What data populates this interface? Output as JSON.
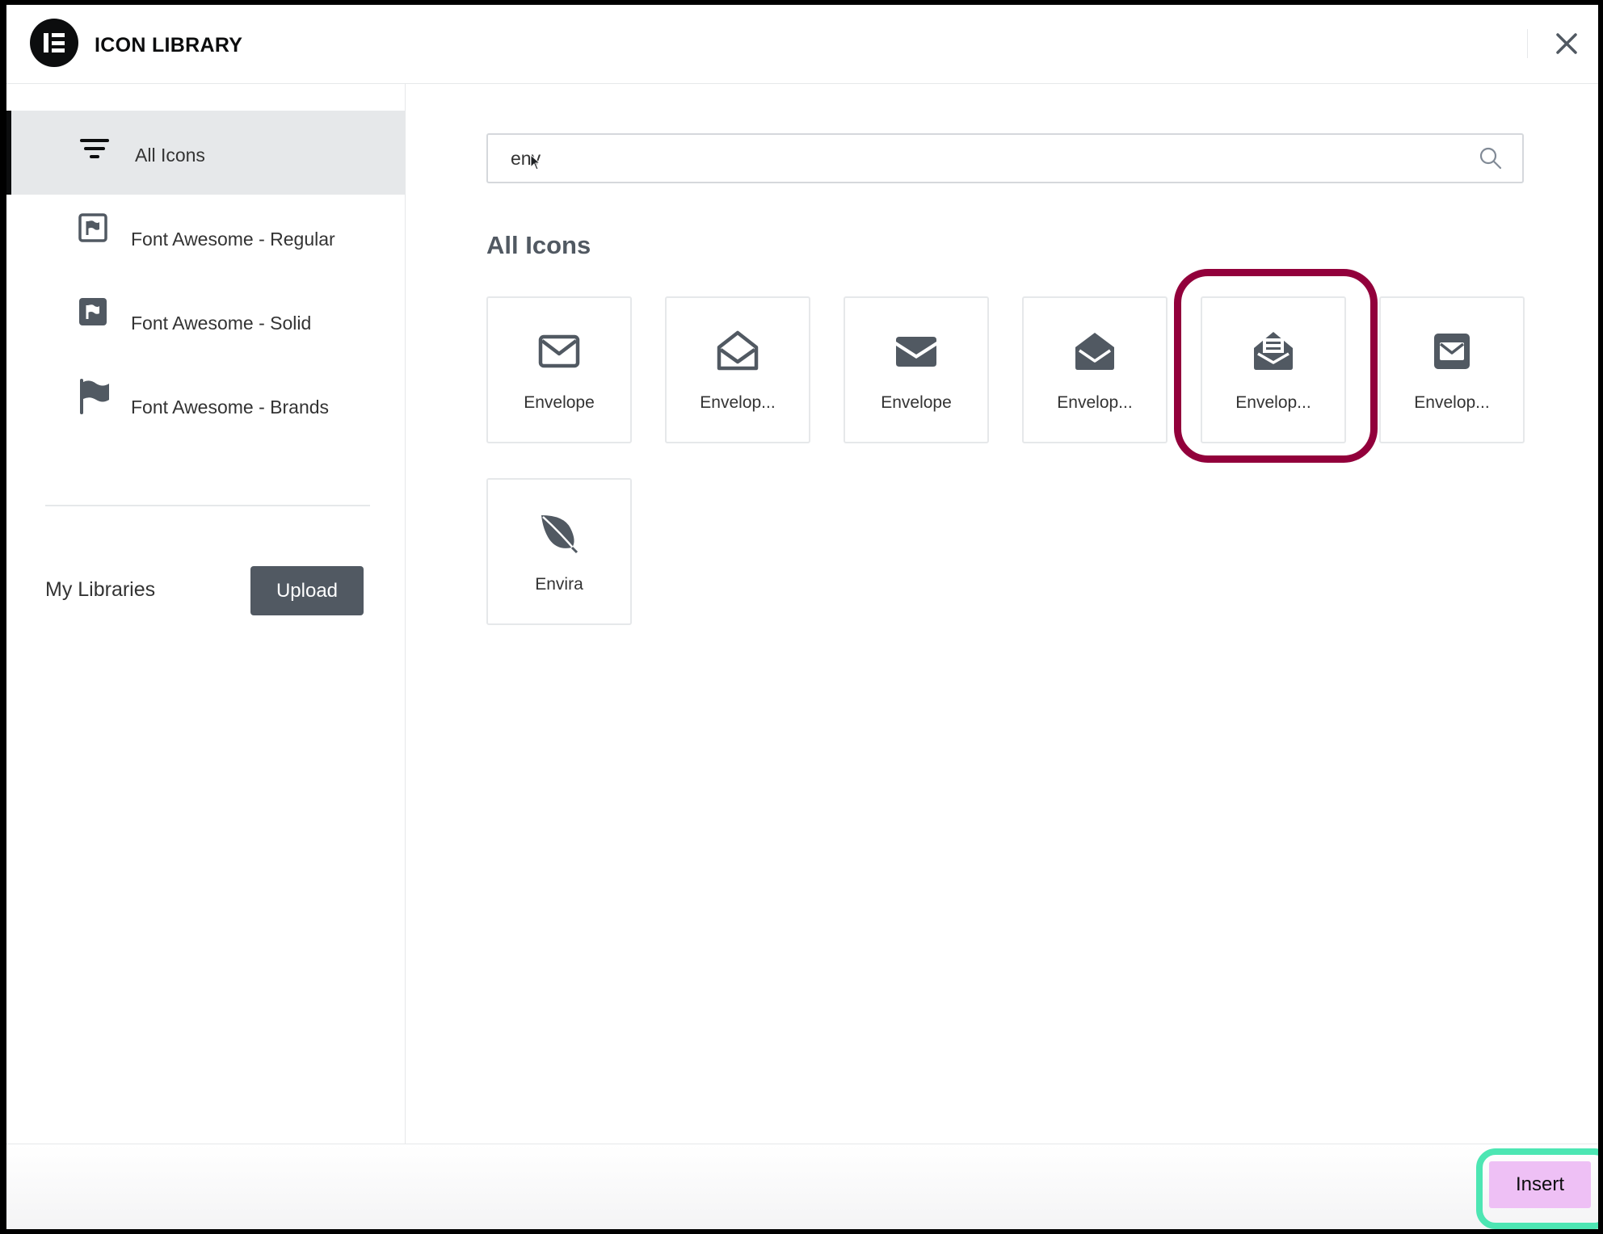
{
  "header": {
    "title": "ICON LIBRARY",
    "logo_icon": "elementor-logo-icon",
    "close_icon": "close-icon"
  },
  "sidebar": {
    "tabs": [
      {
        "label": "All Icons",
        "icon": "filter-lines-icon",
        "active": true
      },
      {
        "label": "Font Awesome - Regular",
        "icon": "flag-outline-icon",
        "active": false
      },
      {
        "label": "Font Awesome - Solid",
        "icon": "flag-solid-icon",
        "active": false
      },
      {
        "label": "Font Awesome - Brands",
        "icon": "flag-waving-icon",
        "active": false
      }
    ],
    "my_libraries_label": "My Libraries",
    "upload_label": "Upload"
  },
  "search": {
    "value": "env",
    "icon": "search-icon"
  },
  "main": {
    "section_title": "All Icons",
    "icons": [
      {
        "label": "Envelope",
        "icon": "envelope-outline-icon"
      },
      {
        "label": "Envelop...",
        "icon": "envelope-open-outline-icon"
      },
      {
        "label": "Envelope",
        "icon": "envelope-solid-icon"
      },
      {
        "label": "Envelop...",
        "icon": "envelope-open-solid-icon"
      },
      {
        "label": "Envelop...",
        "icon": "envelope-open-text-icon",
        "highlighted": true
      },
      {
        "label": "Envelop...",
        "icon": "envelope-square-icon"
      },
      {
        "label": "Envira",
        "icon": "envira-leaf-icon"
      }
    ]
  },
  "footer": {
    "insert_label": "Insert"
  },
  "colors": {
    "highlight_ring": "#92003b",
    "insert_ring": "#4de6b3",
    "insert_button": "#eec0f5",
    "upload_button": "#515962"
  }
}
